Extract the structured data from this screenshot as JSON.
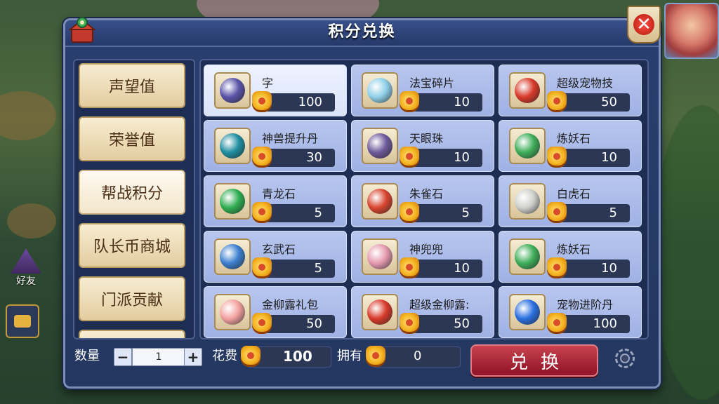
{
  "window": {
    "title": "积分兑换",
    "close_symbol": "✕"
  },
  "tabs": [
    "声望值",
    "荣誉值",
    "帮战积分",
    "队长币商城",
    "门派贡献"
  ],
  "active_tab": 2,
  "items": [
    {
      "name": "字",
      "cost": "100",
      "icon": "scroll-icon",
      "color": "#5a54a8"
    },
    {
      "name": "法宝碎片",
      "cost": "10",
      "icon": "ghost-fragment-icon",
      "color": "#8fd0e8"
    },
    {
      "name": "超级宠物技",
      "cost": "50",
      "icon": "gift-box-icon",
      "color": "#d83a2a"
    },
    {
      "name": "神兽提升丹",
      "cost": "30",
      "icon": "orb-icon",
      "color": "#1f8fa0"
    },
    {
      "name": "天眼珠",
      "cost": "10",
      "icon": "eye-orb-icon",
      "color": "#6e5a9a"
    },
    {
      "name": "炼妖石",
      "cost": "10",
      "icon": "green-crystal-icon",
      "color": "#3fae5a"
    },
    {
      "name": "青龙石",
      "cost": "5",
      "icon": "dragon-stone-icon",
      "color": "#2fae52"
    },
    {
      "name": "朱雀石",
      "cost": "5",
      "icon": "phoenix-stone-icon",
      "color": "#d8452f"
    },
    {
      "name": "白虎石",
      "cost": "5",
      "icon": "tiger-stone-icon",
      "color": "#cfd0cc"
    },
    {
      "name": "玄武石",
      "cost": "5",
      "icon": "turtle-stone-icon",
      "color": "#3c7fcf"
    },
    {
      "name": "神兜兜",
      "cost": "10",
      "icon": "pouch-icon",
      "color": "#e59ab0"
    },
    {
      "name": "炼妖石",
      "cost": "10",
      "icon": "green-crystal-icon",
      "color": "#3fae5a"
    },
    {
      "name": "金柳露礼包",
      "cost": "50",
      "icon": "peach-icon",
      "color": "#f2a2a0"
    },
    {
      "name": "超级金柳露:",
      "cost": "50",
      "icon": "gift-box-icon",
      "color": "#d83a2a"
    },
    {
      "name": "宠物进阶丹",
      "cost": "100",
      "icon": "question-orb-icon",
      "color": "#2a6fe0"
    }
  ],
  "selected_item": 0,
  "bottom": {
    "quantity_label": "数量",
    "quantity_value": "1",
    "minus": "−",
    "plus": "+",
    "cost_label": "花费",
    "cost_value": "100",
    "own_label": "拥有",
    "own_value": "0",
    "exchange_label": "兑换"
  },
  "sidebar_game": {
    "friend_label": "好友"
  }
}
